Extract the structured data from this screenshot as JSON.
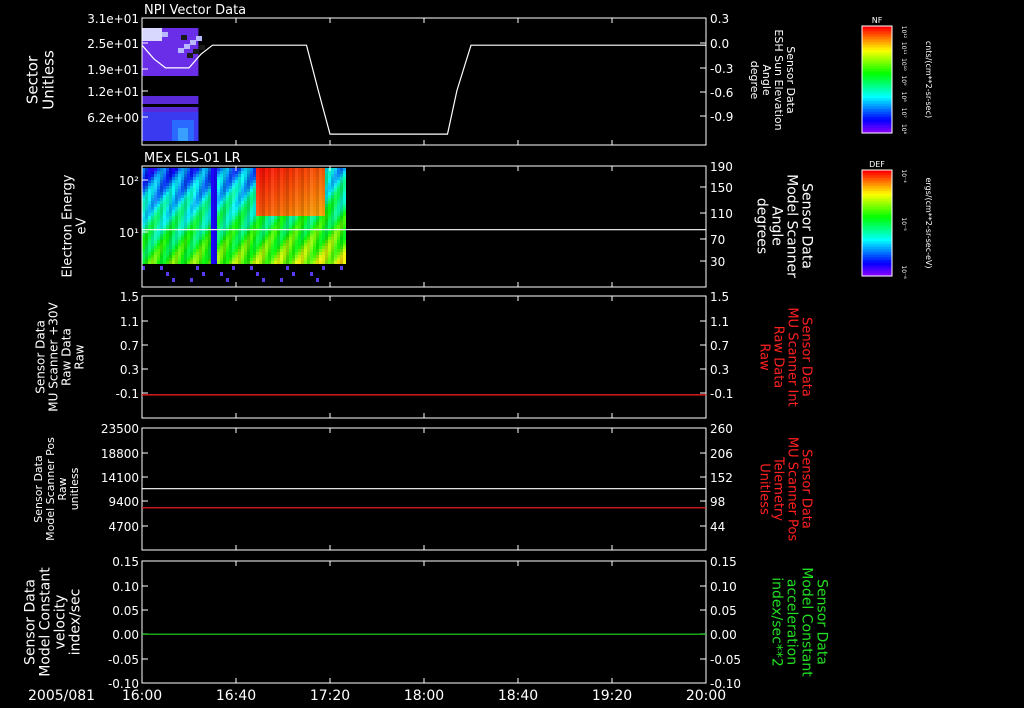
{
  "date_label": "2005/081",
  "time_axis": {
    "range": [
      "16:00",
      "20:00"
    ],
    "ticks": [
      "16:00",
      "16:40",
      "17:20",
      "18:00",
      "18:40",
      "19:20",
      "20:00"
    ]
  },
  "colors": {
    "background": "#000000",
    "axes": "#ffffff",
    "red_series": "#ff2020",
    "green_series": "#22dd22"
  },
  "chart_data": [
    {
      "type": "heatmap",
      "title": "NPI Vector Data",
      "ylabel": [
        "Sector",
        "Unitless"
      ],
      "yticks": [
        "3.1e+01",
        "2.5e+01",
        "1.9e+01",
        "1.2e+01",
        "6.2e+00"
      ],
      "data_extent_x": [
        "16:00",
        "16:24"
      ],
      "colorbar": {
        "label": "NF",
        "unit": "cnts/(cm**2-sr-sec)",
        "ticks": [
          "10¹²",
          "10¹¹",
          "10¹⁰",
          "10⁹",
          "10⁸",
          "10⁷",
          "10⁶"
        ]
      },
      "overlay": {
        "type": "line",
        "color": "#ffffff",
        "ylabel": [
          "Sensor Data",
          "ESH Sun Elevation",
          "Angle",
          "degree"
        ],
        "yticks": [
          "0.3",
          "0.0",
          "-0.3",
          "-0.6",
          "-0.9"
        ],
        "ylim": [
          -1.1,
          0.3
        ],
        "x": [
          "16:00",
          "16:05",
          "16:10",
          "16:20",
          "16:25",
          "16:30",
          "16:35",
          "17:10",
          "17:15",
          "17:20",
          "18:00",
          "18:10",
          "18:14",
          "18:20",
          "20:00"
        ],
        "y": [
          0.0,
          -0.15,
          -0.25,
          -0.25,
          -0.1,
          0.0,
          0.0,
          0.0,
          -0.5,
          -0.98,
          -0.98,
          -0.98,
          -0.5,
          0.0,
          0.0
        ]
      }
    },
    {
      "type": "heatmap",
      "title": "MEx ELS-01 LR",
      "ylabel": [
        "Electron Energy",
        "eV"
      ],
      "yscale": "log",
      "yticks": [
        "10²",
        "10¹"
      ],
      "data_extent_x": [
        "16:00",
        "17:26"
      ],
      "colorbar": {
        "label": "DEF",
        "unit": "ergs/(cm**2-sr-sec-eV)",
        "ticks": [
          "10⁻⁴",
          "10⁻⁵",
          "10⁻⁶"
        ]
      },
      "overlay": {
        "type": "line",
        "color": "#ffffff",
        "ylabel": [
          "Sensor Data",
          "Model Scanner",
          "Angle",
          "degrees"
        ],
        "yticks": [
          "190",
          "150",
          "110",
          "70",
          "30"
        ],
        "ylim": [
          0,
          190
        ],
        "x": [
          "16:00",
          "20:00"
        ],
        "y": [
          90,
          90
        ]
      }
    },
    {
      "type": "line",
      "ylabel": [
        "Sensor Data",
        "MU Scanner +30V",
        "Raw Data",
        "Raw"
      ],
      "yticks": [
        "1.5",
        "1.1",
        "0.7",
        "0.3",
        "-0.1"
      ],
      "ylim": [
        -0.35,
        1.5
      ],
      "right_ylabel": [
        "Sensor Data",
        "MU Scanner Int",
        "Raw Data",
        "Raw"
      ],
      "right_yticks": [
        "1.5",
        "1.1",
        "0.7",
        "0.3",
        "-0.1"
      ],
      "series": [
        {
          "name": "MU Scanner Int",
          "color": "#ff2020",
          "x": [
            "16:00",
            "20:00"
          ],
          "y": [
            0.0,
            0.0
          ]
        }
      ]
    },
    {
      "type": "line",
      "ylabel": [
        "Sensor Data",
        "Model Scanner Pos",
        "Raw",
        "unitless"
      ],
      "yticks": [
        "23500",
        "18800",
        "14100",
        "9400",
        "4700"
      ],
      "ylim": [
        0,
        23500
      ],
      "right_ylabel": [
        "Sensor Data",
        "MU Scanner Pos",
        "Telemetry",
        "Unitless"
      ],
      "right_yticks": [
        "260",
        "206",
        "152",
        "98",
        "44"
      ],
      "right_ylim": [
        0,
        260
      ],
      "series": [
        {
          "name": "Model Scanner Pos",
          "color": "#ffffff",
          "axis": "left",
          "x": [
            "16:00",
            "20:00"
          ],
          "y": [
            11800,
            11800
          ]
        },
        {
          "name": "MU Scanner Pos",
          "color": "#ff2020",
          "axis": "right",
          "x": [
            "16:00",
            "20:00"
          ],
          "y": [
            90,
            90
          ]
        }
      ]
    },
    {
      "type": "line",
      "ylabel": [
        "Sensor Data",
        "Model Constant",
        "velocity",
        "index/sec"
      ],
      "yticks": [
        "0.15",
        "0.10",
        "0.05",
        "0.00",
        "-0.05",
        "-0.10"
      ],
      "ylim": [
        -0.1,
        0.15
      ],
      "right_ylabel": [
        "Sensor Data",
        "Model Constant",
        "acceleration",
        "index/sec**2"
      ],
      "right_yticks": [
        "0.15",
        "0.10",
        "0.05",
        "0.00",
        "-0.05",
        "-0.10"
      ],
      "series": [
        {
          "name": "Model Constant acceleration",
          "color": "#22dd22",
          "x": [
            "16:00",
            "20:00"
          ],
          "y": [
            0.0,
            0.0
          ]
        }
      ]
    }
  ]
}
